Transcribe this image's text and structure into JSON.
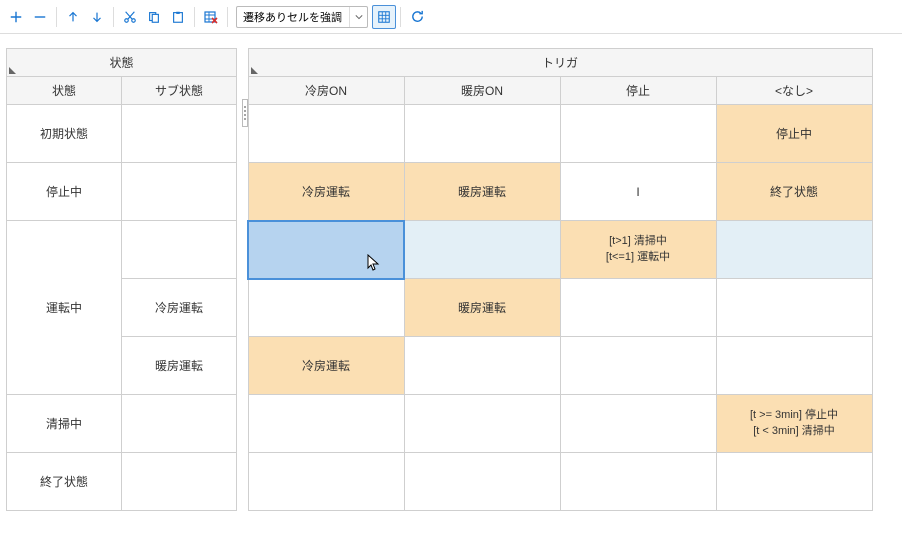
{
  "toolbar": {
    "select_value": "遷移ありセルを強調"
  },
  "left_header_group": "状態",
  "left_cols": [
    "状態",
    "サブ状態"
  ],
  "right_header_group": "トリガ",
  "trigger_cols": [
    "冷房ON",
    "暖房ON",
    "停止",
    "<なし>"
  ],
  "states": [
    "初期状態",
    "停止中",
    "運転中",
    "清掃中",
    "終了状態"
  ],
  "substates": {
    "untenchu_cooling": "冷房運転",
    "untenchu_heating": "暖房運転"
  },
  "cells": {
    "r0_c3": "停止中",
    "r1_c0": "冷房運転",
    "r1_c1": "暖房運転",
    "r1_c2": "I",
    "r1_c3": "終了状態",
    "r2_c2_l1": "[t>1] 清掃中",
    "r2_c2_l2": "[t<=1] 運転中",
    "r3_c1": "暖房運転",
    "r4_c0": "冷房運転",
    "r5_c3_l1": "[t >= 3min] 停止中",
    "r5_c3_l2": "[t < 3min] 清掃中"
  }
}
